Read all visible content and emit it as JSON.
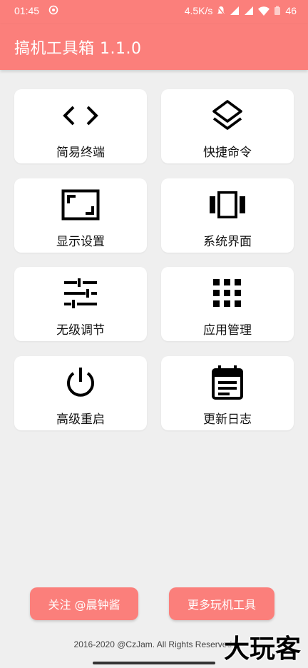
{
  "status_bar": {
    "time": "01:45",
    "network_speed": "4.5K/s",
    "battery": "46"
  },
  "app_bar": {
    "title": "搞机工具箱 1.1.0"
  },
  "tools": [
    {
      "label": "简易终端",
      "icon": "code-brackets-icon"
    },
    {
      "label": "快捷命令",
      "icon": "layers-icon"
    },
    {
      "label": "显示设置",
      "icon": "aspect-ratio-icon"
    },
    {
      "label": "系统界面",
      "icon": "view-carousel-icon"
    },
    {
      "label": "无级调节",
      "icon": "tune-sliders-icon"
    },
    {
      "label": "应用管理",
      "icon": "apps-grid-icon"
    },
    {
      "label": "高级重启",
      "icon": "power-icon"
    },
    {
      "label": "更新日志",
      "icon": "calendar-notes-icon"
    }
  ],
  "buttons": {
    "follow": "关注 @晨钟酱",
    "more_tools": "更多玩机工具"
  },
  "copyright": "2016-2020 @CzJam. All Rights Reserved.",
  "watermark": "大玩客",
  "colors": {
    "accent": "#fb7f7b",
    "background": "#efefef",
    "card": "#ffffff"
  }
}
